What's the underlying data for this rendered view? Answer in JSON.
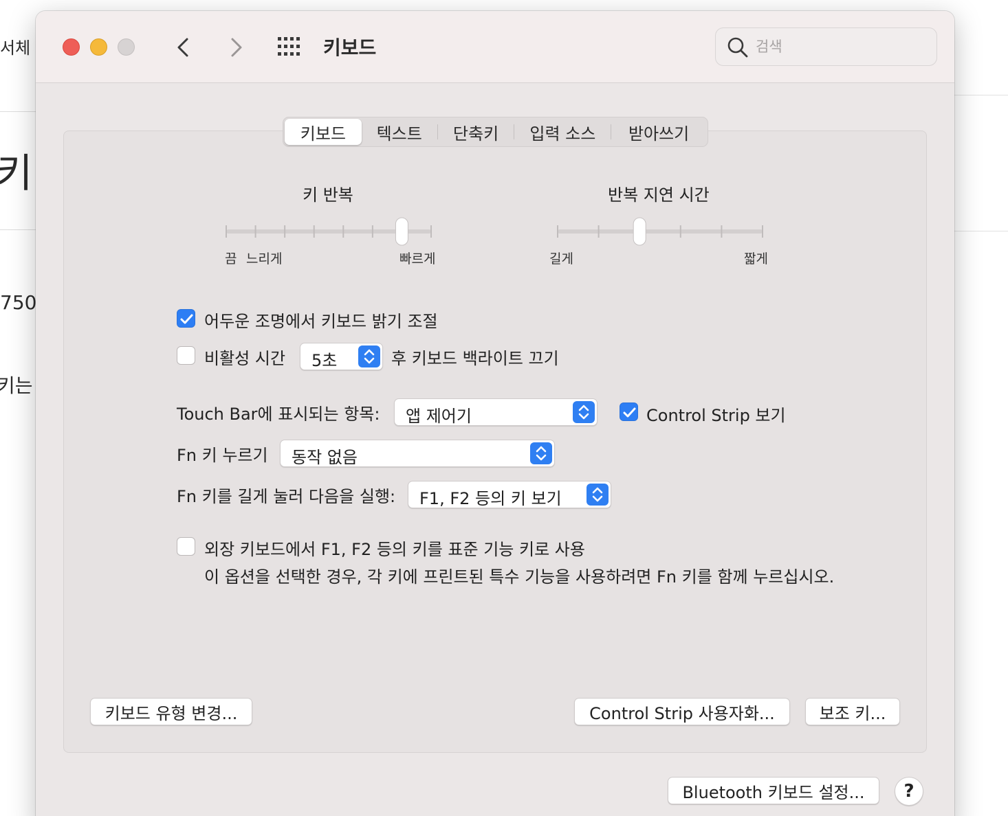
{
  "background_app": {
    "fragments": [
      "서체",
      "키",
      "750",
      "키는"
    ]
  },
  "window": {
    "title": "키보드",
    "search_placeholder": "검색"
  },
  "tabs": [
    {
      "label": "키보드",
      "active": true
    },
    {
      "label": "텍스트",
      "active": false
    },
    {
      "label": "단축키",
      "active": false
    },
    {
      "label": "입력 소스",
      "active": false
    },
    {
      "label": "받아쓰기",
      "active": false
    }
  ],
  "key_repeat": {
    "title": "키 반복",
    "labels": [
      "끔",
      "느리게",
      "빠르게"
    ],
    "tick_count": 8,
    "value_step": 6
  },
  "repeat_delay": {
    "title": "반복 지연 시간",
    "labels": [
      "길게",
      "짧게"
    ],
    "tick_count": 6,
    "value_step": 2
  },
  "options": {
    "auto_brightness": {
      "label": "어두운 조명에서 키보드 밝기 조절",
      "checked": true
    },
    "backlight_off": {
      "label_before": "비활성 시간",
      "value": "5초",
      "label_after": "후 키보드 백라이트 끄기",
      "checked": false
    },
    "touch_bar": {
      "label": "Touch Bar에 표시되는 항목:",
      "value": "앱 제어기"
    },
    "control_strip": {
      "label": "Control Strip 보기",
      "checked": true
    },
    "fn_press": {
      "label": "Fn 키 누르기",
      "value": "동작 없음"
    },
    "fn_hold": {
      "label": "Fn 키를 길게 눌러 다음을 실행:",
      "value": "F1, F2 등의 키 보기"
    },
    "function_keys": {
      "label": "외장 키보드에서 F1, F2 등의 키를 표준 기능 키로 사용",
      "description": "이 옵션을 선택한 경우, 각 키에 프린트된 특수 기능을 사용하려면 Fn 키를 함께 누르십시오.",
      "checked": false
    }
  },
  "buttons": {
    "change_keyboard_type": "키보드 유형 변경...",
    "customize_control_strip": "Control Strip 사용자화...",
    "modifier_keys": "보조 키...",
    "bluetooth_setup": "Bluetooth 키보드 설정...",
    "help": "?"
  },
  "colors": {
    "accent": "#2d7ef4",
    "close": "#ee5e57",
    "minimize": "#f5b93a",
    "zoom_disabled": "#d7d3d3"
  }
}
